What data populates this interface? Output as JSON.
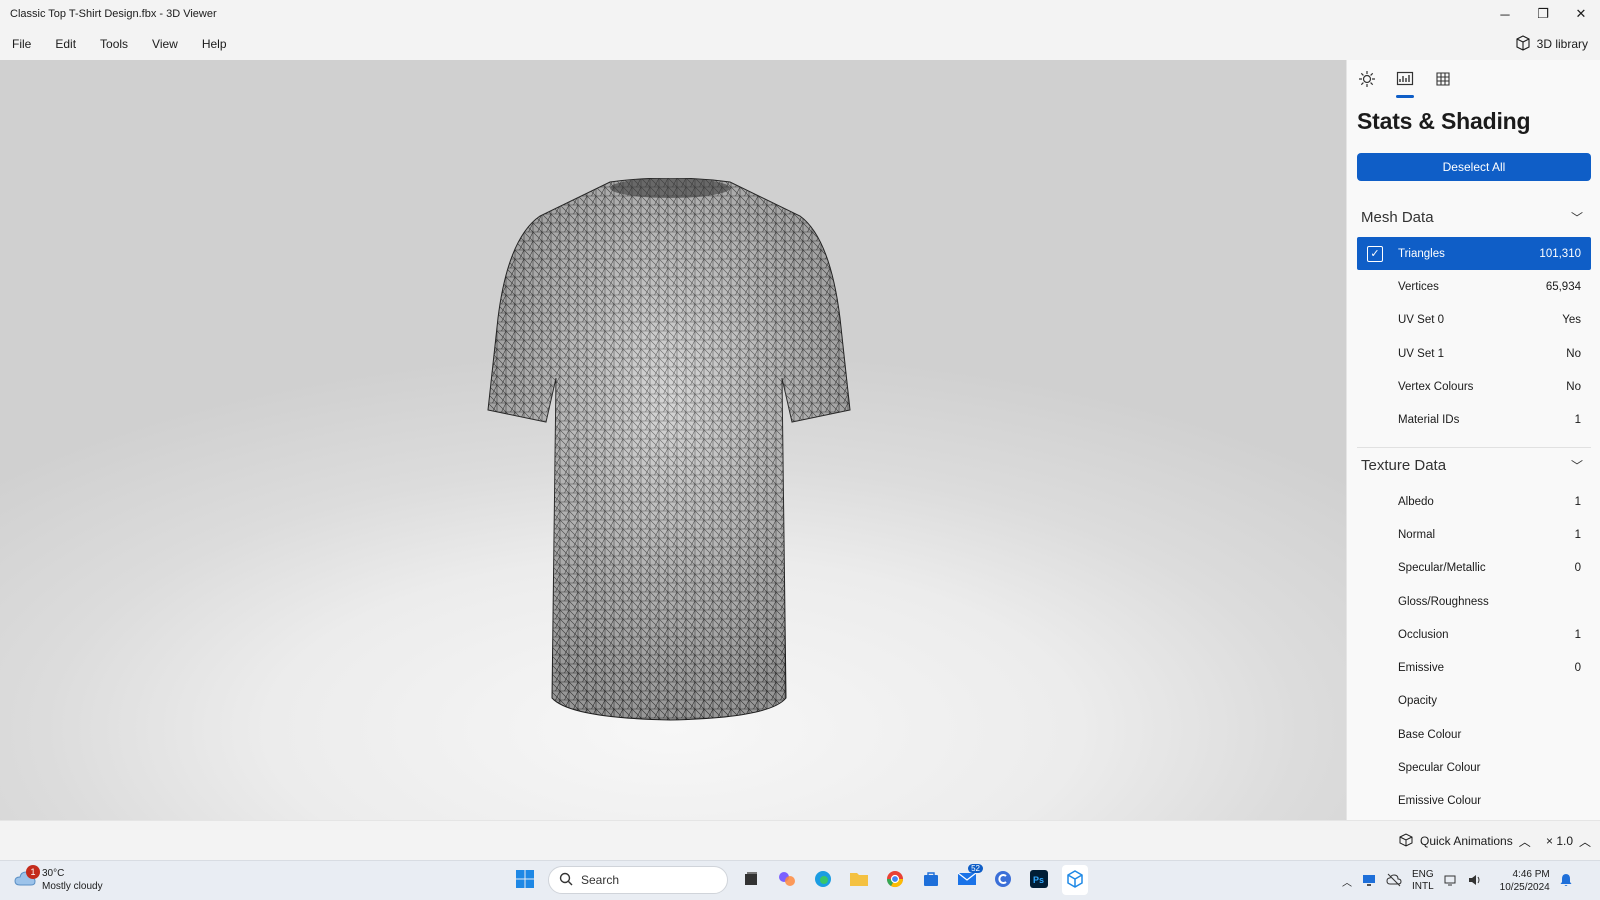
{
  "window": {
    "title": "Classic Top T-Shirt Design.fbx - 3D Viewer",
    "minimize_glyph": "─",
    "maximize_glyph": "❐",
    "close_glyph": "✕"
  },
  "menu": {
    "items": [
      "File",
      "Edit",
      "Tools",
      "View",
      "Help"
    ],
    "library_label": "3D library"
  },
  "panel": {
    "tabs": [
      {
        "icon": "sun-icon",
        "active": false
      },
      {
        "icon": "stats-icon",
        "active": true
      },
      {
        "icon": "grid-icon",
        "active": false
      }
    ],
    "title": "Stats & Shading",
    "deselect_label": "Deselect All",
    "mesh_section": {
      "title": "Mesh Data",
      "rows": [
        {
          "label": "Triangles",
          "value": "101,310",
          "selected": true
        },
        {
          "label": "Vertices",
          "value": "65,934"
        },
        {
          "label": "UV Set 0",
          "value": "Yes"
        },
        {
          "label": "UV Set 1",
          "value": "No"
        },
        {
          "label": "Vertex Colours",
          "value": "No"
        },
        {
          "label": "Material IDs",
          "value": "1"
        }
      ]
    },
    "texture_section": {
      "title": "Texture Data",
      "rows": [
        {
          "label": "Albedo",
          "value": "1"
        },
        {
          "label": "Normal",
          "value": "1"
        },
        {
          "label": "Specular/Metallic",
          "value": "0"
        },
        {
          "label": "Gloss/Roughness",
          "value": ""
        },
        {
          "label": "Occlusion",
          "value": "1"
        },
        {
          "label": "Emissive",
          "value": "0"
        },
        {
          "label": "Opacity",
          "value": ""
        },
        {
          "label": "Base Colour",
          "value": ""
        },
        {
          "label": "Specular Colour",
          "value": ""
        },
        {
          "label": "Emissive Colour",
          "value": ""
        }
      ]
    }
  },
  "bottom": {
    "quick_animations_label": "Quick Animations",
    "speed_label": "× 1.0"
  },
  "taskbar": {
    "weather_temp": "30°C",
    "weather_desc": "Mostly cloudy",
    "weather_badge": "1",
    "search_placeholder": "Search",
    "mail_badge": "52",
    "lang_line1": "ENG",
    "lang_line2": "INTL",
    "time": "4:46 PM",
    "date": "10/25/2024"
  },
  "colors": {
    "accent": "#0f5ec7",
    "panel_bg": "#f9f9f9",
    "chrome_bg": "#f3f3f3"
  }
}
